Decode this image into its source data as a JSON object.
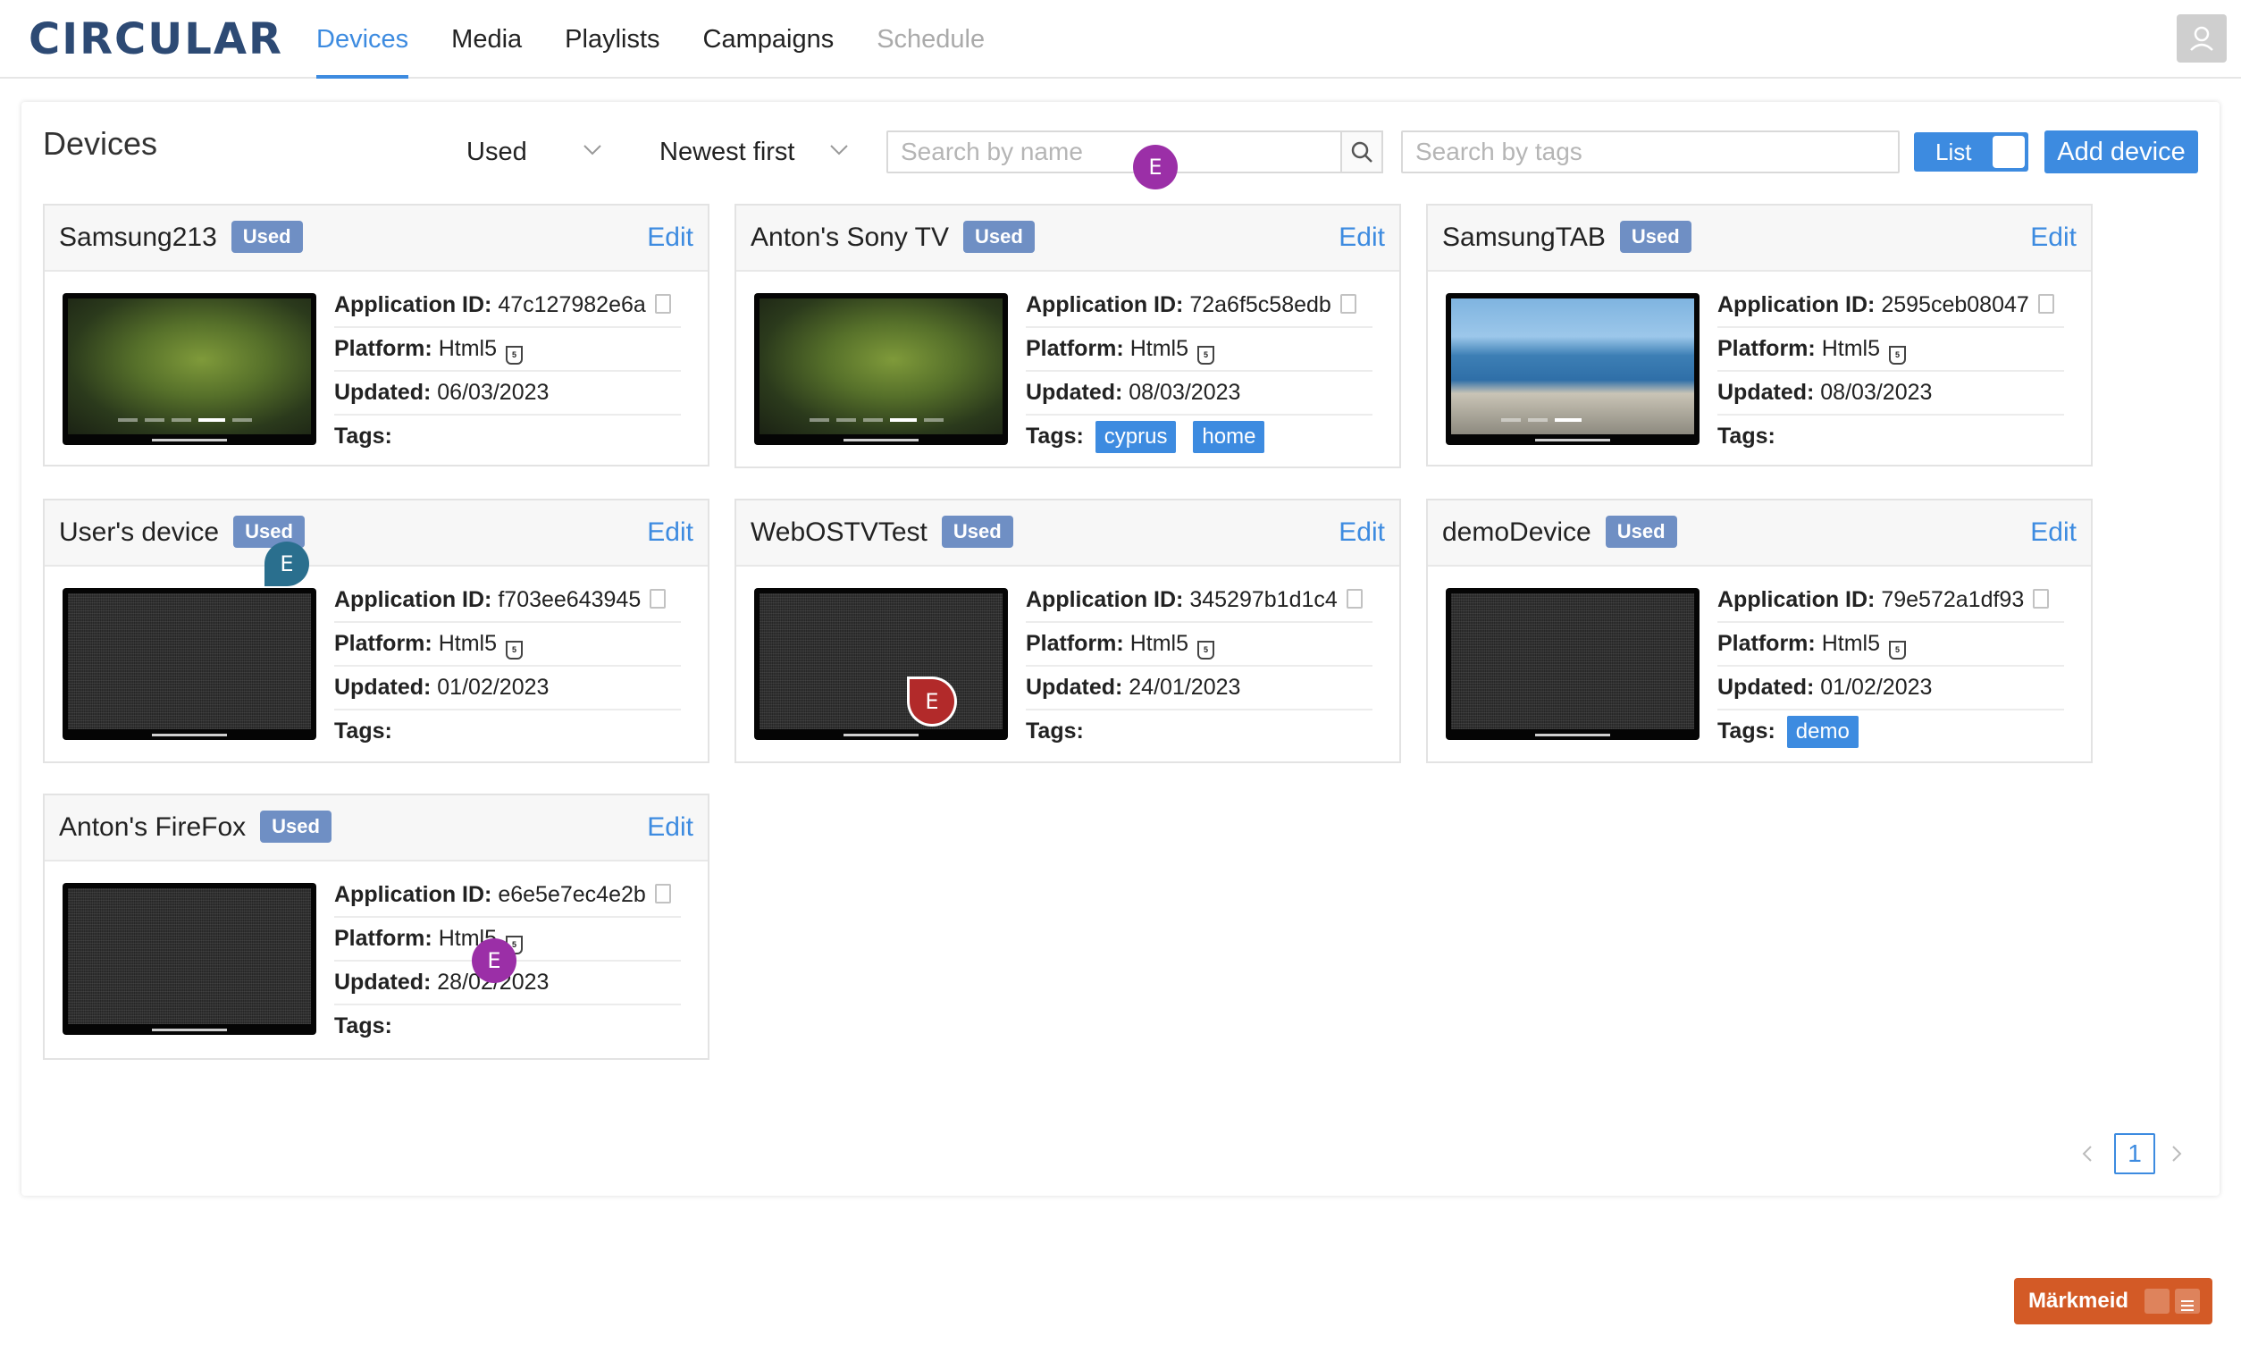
{
  "brand": {
    "logo_text": "CIRCULAR"
  },
  "nav": {
    "tabs": [
      {
        "label": "Devices",
        "state": "active"
      },
      {
        "label": "Media",
        "state": "normal"
      },
      {
        "label": "Playlists",
        "state": "normal"
      },
      {
        "label": "Campaigns",
        "state": "normal"
      },
      {
        "label": "Schedule",
        "state": "disabled"
      }
    ]
  },
  "toolbar": {
    "title": "Devices",
    "status_filter": "Used",
    "sort": "Newest first",
    "search_name_placeholder": "Search by name",
    "search_tags_placeholder": "Search by tags",
    "list_toggle_label": "List",
    "add_device_label": "Add device"
  },
  "labels": {
    "app_id": "Application ID:",
    "platform": "Platform:",
    "updated": "Updated:",
    "tags": "Tags:",
    "edit": "Edit"
  },
  "devices": [
    {
      "name": "Samsung213",
      "badge": "Used",
      "app_id": "47c127982e6a",
      "platform": "Html5",
      "updated": "06/03/2023",
      "tags": [],
      "thumbnail": "leaf",
      "active_dot": 3
    },
    {
      "name": "Anton's Sony TV",
      "badge": "Used",
      "app_id": "72a6f5c58edb",
      "platform": "Html5",
      "updated": "08/03/2023",
      "tags": [
        "cyprus",
        "home"
      ],
      "thumbnail": "leaf",
      "active_dot": 3
    },
    {
      "name": "SamsungTAB",
      "badge": "Used",
      "app_id": "2595ceb08047",
      "platform": "Html5",
      "updated": "08/03/2023",
      "tags": [],
      "thumbnail": "coast",
      "active_dot": 2
    },
    {
      "name": "User's device",
      "badge": "Used",
      "app_id": "f703ee643945",
      "platform": "Html5",
      "updated": "01/02/2023",
      "tags": [],
      "thumbnail": "noise"
    },
    {
      "name": "WebOSTVTest",
      "badge": "Used",
      "app_id": "345297b1d1c4",
      "platform": "Html5",
      "updated": "24/01/2023",
      "tags": [],
      "thumbnail": "noise"
    },
    {
      "name": "demoDevice",
      "badge": "Used",
      "app_id": "79e572a1df93",
      "platform": "Html5",
      "updated": "01/02/2023",
      "tags": [
        "demo"
      ],
      "thumbnail": "noise"
    },
    {
      "name": "Anton's FireFox",
      "badge": "Used",
      "app_id": "e6e5e7ec4e2b",
      "platform": "Html5",
      "updated": "28/02/2023",
      "tags": [],
      "thumbnail": "noise"
    }
  ],
  "pagination": {
    "prev_icon": "chevron-left-icon",
    "current_page": "1",
    "next_icon": "chevron-right-icon"
  },
  "markers": [
    {
      "letter": "E",
      "color": "#9b2fa7"
    },
    {
      "letter": "E",
      "color": "#2a6f8e"
    },
    {
      "letter": "E",
      "color": "#b22a2a"
    },
    {
      "letter": "E",
      "color": "#9b2fa7"
    }
  ],
  "widget": {
    "label": "Märkmeid",
    "icons": [
      "touch-icon",
      "menu-icon"
    ],
    "color": "#d35a26"
  },
  "colors": {
    "accent": "#3d8be0",
    "badge": "#6f8fc4",
    "logo": "#2d4a74"
  }
}
